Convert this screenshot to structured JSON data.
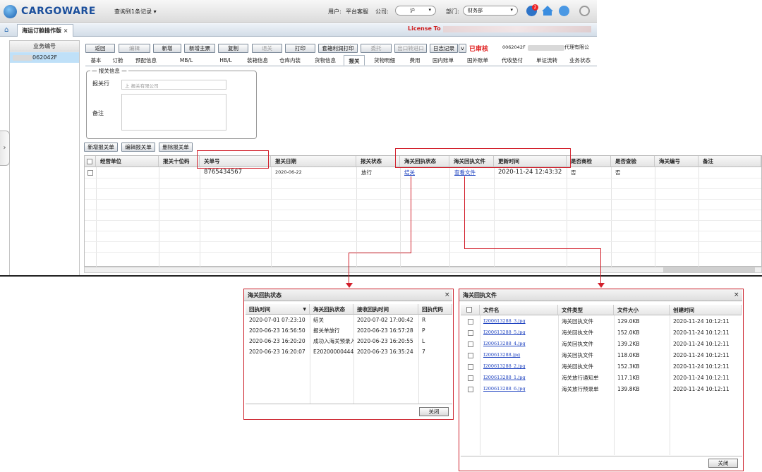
{
  "app": {
    "brand": "CARGOWARE",
    "query_info": "查询到1条记录",
    "user_label": "用户:",
    "user_value": "平台客服",
    "company_label": "公司:",
    "company_value": "沪",
    "dept_label": "部门:",
    "dept_value": "财务部",
    "notify_count": "2"
  },
  "tabs": {
    "current": "海运订舱操作版",
    "close": "×"
  },
  "license": "License To",
  "left_panel": {
    "header": "业务编号",
    "row": "062042F"
  },
  "toolbar": {
    "buttons": [
      "返回",
      "编辑",
      "新增",
      "新增主票",
      "复制",
      "退关",
      "打印",
      "套箱利润打印",
      "委托",
      "出口转进口",
      "日志记录"
    ],
    "log_arrow": "v",
    "audit": "已审核",
    "info": "0062042F",
    "agency": "代理有限公"
  },
  "subtabs": [
    "基本",
    "订舱",
    "预配信息",
    "MB/L",
    "HB/L",
    "装箱信息",
    "仓库内装",
    "货物信息",
    "报关",
    "货物明细",
    "费用",
    "国内账单",
    "国外账单",
    "代收垫付",
    "单证流转",
    "业务状态"
  ],
  "customs_info": {
    "legend": "报关信息",
    "broker_label": "报关行",
    "broker_value": "上      报关有限公司",
    "remark_label": "备注"
  },
  "actions": [
    "新增报关单",
    "编辑报关单",
    "删除报关单"
  ],
  "grid": {
    "headers": [
      "经营单位",
      "报关十位码",
      "关单号",
      "报关日期",
      "报关状态",
      "海关回执状态",
      "海关回执文件",
      "更新时间",
      "是否商检",
      "是否查验",
      "海关编号",
      "备注"
    ],
    "row": {
      "declaration_no": "8765434567",
      "date": "2020-06-22",
      "status": "放行",
      "receipt_status": "结关",
      "receipt_file": "查看文件",
      "updated": "2020-11-24 12:43:32",
      "inspection": "否",
      "checked": "否"
    }
  },
  "popup_status": {
    "title": "海关回执状态",
    "close": "×",
    "headers": [
      "回执时间",
      "海关回执状态",
      "接收回执时间",
      "回执代码"
    ],
    "sort_icon": "▼",
    "rows": [
      [
        "2020-07-01 07:23:10",
        "结关",
        "2020-07-02 17:00:42",
        "R"
      ],
      [
        "2020-06-23 16:56:50",
        "报关单放行",
        "2020-06-23 16:57:28",
        "P"
      ],
      [
        "2020-06-23 16:20:20",
        "成功入海关预录入",
        "2020-06-23 16:20:55",
        "L"
      ],
      [
        "2020-06-23 16:20:07",
        "E2020000044427",
        "2020-06-23 16:35:24",
        "7"
      ]
    ],
    "button": "关闭"
  },
  "popup_files": {
    "title": "海关回执文件",
    "close": "×",
    "headers": [
      "文件名",
      "文件类型",
      "文件大小",
      "创建时间"
    ],
    "rows": [
      [
        "I200613288_3.jpg",
        "海关回执文件",
        "129.0KB",
        "2020-11-24 10:12:11"
      ],
      [
        "I200613288_5.jpg",
        "海关回执文件",
        "152.0KB",
        "2020-11-24 10:12:11"
      ],
      [
        "I200613288_4.jpg",
        "海关回执文件",
        "139.2KB",
        "2020-11-24 10:12:11"
      ],
      [
        "I200613288.jpg",
        "海关回执文件",
        "118.0KB",
        "2020-11-24 10:12:11"
      ],
      [
        "I200613288_2.jpg",
        "海关回执文件",
        "152.3KB",
        "2020-11-24 10:12:11"
      ],
      [
        "I200613288_1.jpg",
        "海关放行通知单",
        "117.1KB",
        "2020-11-24 10:12:11"
      ],
      [
        "I200613288_6.jpg",
        "海关放行预录单",
        "139.8KB",
        "2020-11-24 10:12:11"
      ]
    ],
    "button": "关闭"
  }
}
